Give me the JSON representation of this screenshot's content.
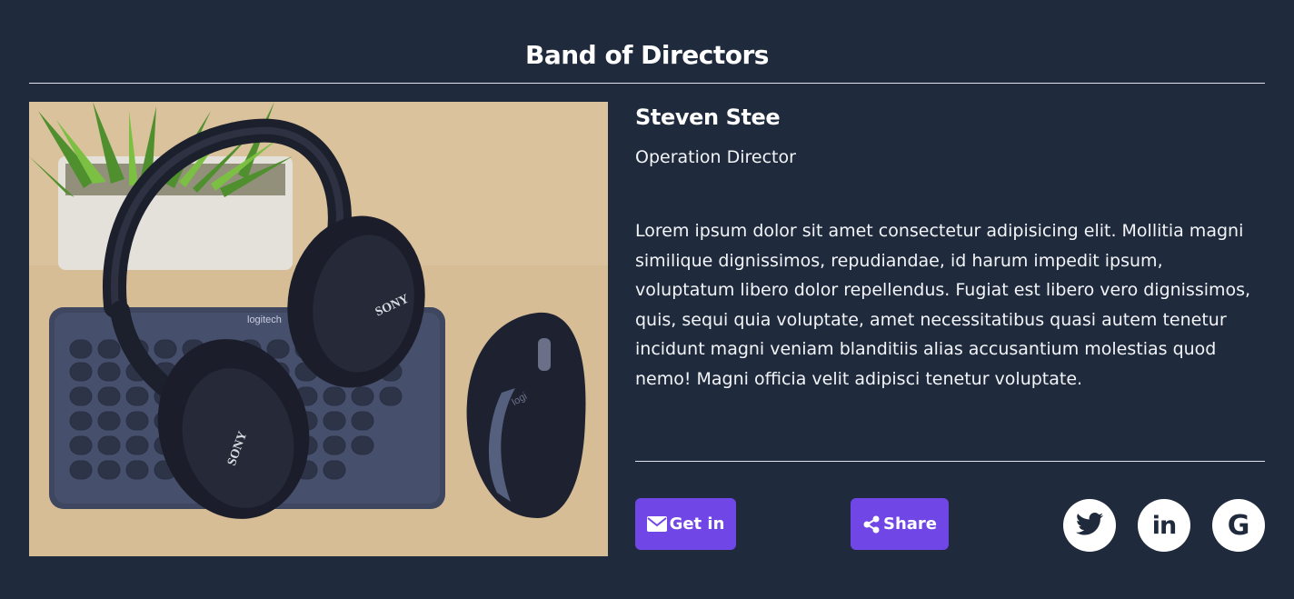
{
  "section": {
    "title": "Band of Directors"
  },
  "director": {
    "name": "Steven Stee",
    "role": "Operation Director",
    "bio": "Lorem ipsum dolor sit amet consectetur adipisicing elit. Mollitia magni similique dignissimos, repudiandae, id harum impedit ipsum, voluptatum libero dolor repellendus. Fugiat est libero vero dignissimos, quis, sequi quia voluptate, amet necessitatibus quasi autem tenetur incidunt magni veniam blanditiis alias accusantium molestias quod nemo! Magni officia velit adipisci tenetur voluptate."
  },
  "photo": {
    "keyboard_brand": "logitech",
    "headphone_brand": "SONY",
    "mouse_brand": "logi"
  },
  "actions": {
    "get_in_label": "Get in",
    "get_in_icon": "envelope-icon",
    "share_label": "Share",
    "share_icon": "share-icon"
  },
  "social": {
    "twitter_icon": "twitter-icon",
    "linkedin_text": "in",
    "google_text": "G"
  },
  "colors": {
    "background": "#1f2a3c",
    "accent": "#7046e6",
    "text": "#ffffff"
  }
}
